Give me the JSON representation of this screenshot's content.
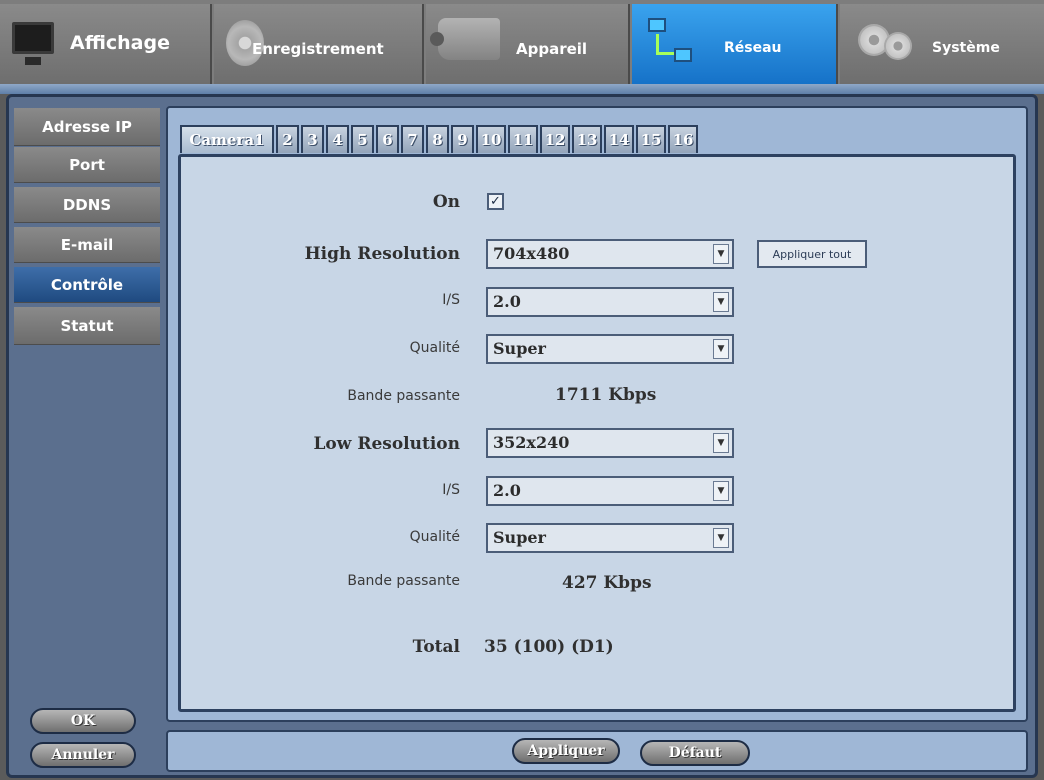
{
  "topmenu": {
    "items": [
      {
        "label": "Affichage",
        "icon": "monitor-icon"
      },
      {
        "label": "Enregistrement",
        "icon": "disk-icon"
      },
      {
        "label": "Appareil",
        "icon": "camera-icon"
      },
      {
        "label": "Réseau",
        "icon": "network-icon"
      },
      {
        "label": "Système",
        "icon": "gear-icon"
      }
    ],
    "active": "Réseau"
  },
  "sidebar": {
    "items": [
      {
        "label": "Adresse IP"
      },
      {
        "label": "Port"
      },
      {
        "label": "DDNS"
      },
      {
        "label": "E-mail"
      },
      {
        "label": "Contrôle"
      },
      {
        "label": "Statut"
      }
    ],
    "active": "Contrôle",
    "ok_label": "OK",
    "cancel_label": "Annuler"
  },
  "camera_tabs": {
    "items": [
      "Camera1",
      "2",
      "3",
      "4",
      "5",
      "6",
      "7",
      "8",
      "9",
      "10",
      "11",
      "12",
      "13",
      "14",
      "15",
      "16"
    ],
    "active": "Camera1"
  },
  "form": {
    "on_label": "On",
    "on_checked": true,
    "on_mark": "✓",
    "high_res_label": "High Resolution",
    "high_res_value": "704x480",
    "apply_all_label": "Appliquer tout",
    "high_ips_label": "I/S",
    "high_ips_value": "2.0",
    "high_quality_label": "Qualité",
    "high_quality_value": "Super",
    "high_bandwidth_label": "Bande passante",
    "high_bandwidth_value": "1711 Kbps",
    "low_res_label": "Low Resolution",
    "low_res_value": "352x240",
    "low_ips_label": "I/S",
    "low_ips_value": "2.0",
    "low_quality_label": "Qualité",
    "low_quality_value": "Super",
    "low_bandwidth_label": "Bande passante",
    "low_bandwidth_value": "427 Kbps",
    "total_label": "Total",
    "total_value": "35 (100) (D1)",
    "dropdown_arrow": "▼"
  },
  "footer": {
    "apply_label": "Appliquer",
    "default_label": "Défaut"
  },
  "colors": {
    "active_tab": "#1672c8",
    "active_sidebar": "#1f4a80",
    "panel": "#9fb7d6",
    "inner": "#c8d6e6"
  }
}
